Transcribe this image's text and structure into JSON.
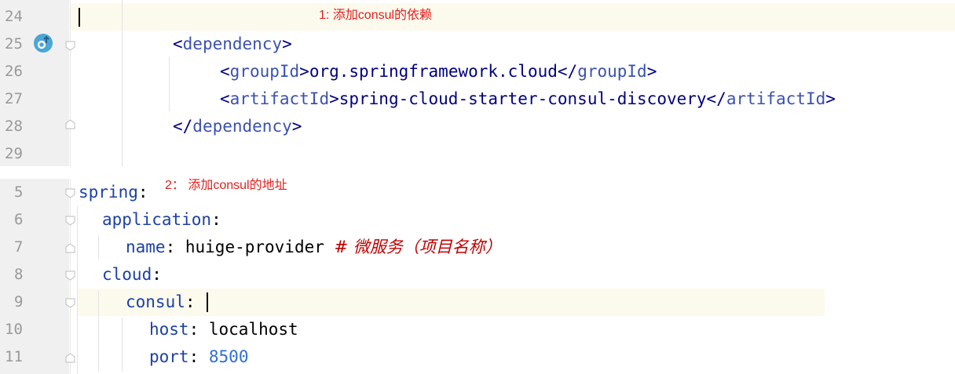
{
  "panel1": {
    "line_numbers": [
      "24",
      "25",
      "26",
      "27",
      "28",
      "29"
    ],
    "annotation": "1: 添加consul的依赖",
    "code": {
      "l25": {
        "open": "<",
        "name": "dependency",
        "close": ">"
      },
      "l26": {
        "open": "<",
        "name": "groupId",
        "mid": ">org.springframework.cloud</",
        "name2": "groupId",
        "close": ">"
      },
      "l27": {
        "open": "<",
        "name": "artifactId",
        "mid": ">spring-cloud-starter-consul-discovery</",
        "name2": "artifactId",
        "close": ">"
      },
      "l28": {
        "open": "</",
        "name": "dependency",
        "close": ">"
      }
    }
  },
  "panel2": {
    "line_numbers": [
      "5",
      "6",
      "7",
      "8",
      "9",
      "10",
      "11"
    ],
    "annotation": "2： 添加consul的地址",
    "code": {
      "l5": {
        "key": "spring",
        "colon": ":"
      },
      "l6": {
        "key": "application",
        "colon": ":"
      },
      "l7": {
        "key": "name",
        "colon": ":",
        "value": " huige-provider ",
        "comment": "# 微服务（项目名称）"
      },
      "l8": {
        "key": "cloud",
        "colon": ":"
      },
      "l9": {
        "key": "consul",
        "colon": ":"
      },
      "l10": {
        "key": "host",
        "colon": ":",
        "value": " localhost"
      },
      "l11": {
        "key": "port",
        "colon": ":",
        "value": " ",
        "num": "8500"
      }
    }
  },
  "colors": {
    "gutter": "#f0f0f0",
    "highlight": "#fcfaed",
    "annotation": "#e2201f",
    "key": "#1c40a8",
    "tag": "#3b51b0"
  },
  "icons": {
    "vcs": "git-branch-icon",
    "fold": "fold-marker-icon"
  }
}
